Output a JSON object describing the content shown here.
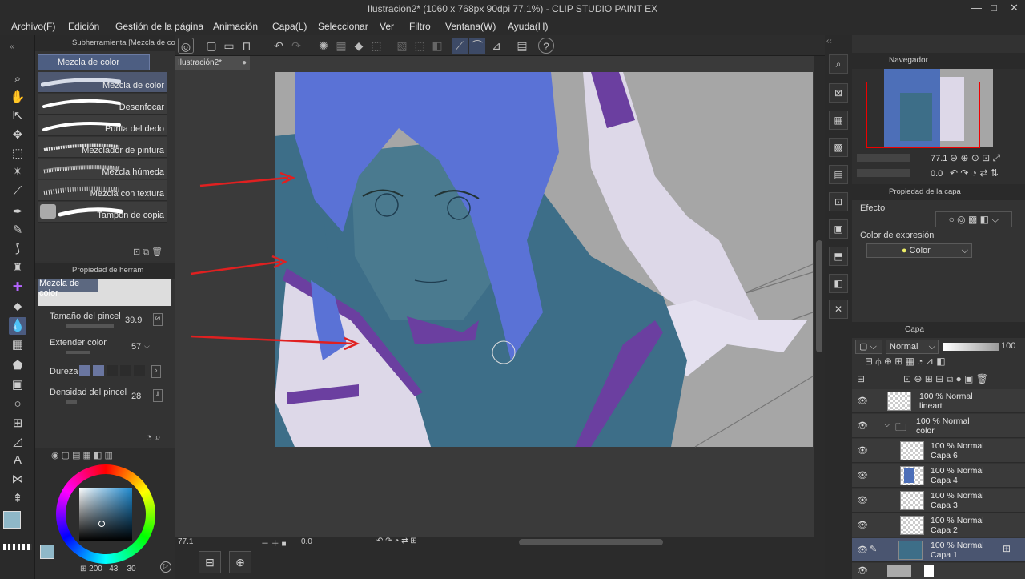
{
  "title": "Ilustración2* (1060 x 768px 90dpi 77.1%)  - CLIP STUDIO PAINT EX",
  "window_controls": {
    "minimize": "—",
    "maximize": "□",
    "close": "✕"
  },
  "menu": [
    "Archivo(F)",
    "Edición",
    "Gestión de la página",
    "Animación",
    "Capa(L)",
    "Seleccionar",
    "Ver",
    "Filtro",
    "Ventana(W)",
    "Ayuda(H)"
  ],
  "subtool_panel": {
    "title": "Subherramienta [Mezcla de co",
    "group": "Mezcla de color",
    "brushes": [
      "Mezcla de color",
      "Desenfocar",
      "Punta del dedo",
      "Mezclador de pintura",
      "Mezcla húmeda",
      "Mezcla con textura",
      "Tampón de copia"
    ]
  },
  "tool_property": {
    "title": "Propiedad de herram",
    "tool_name": "Mezcla de color",
    "brush_size_label": "Tamaño del pincel",
    "brush_size": "39.9",
    "extend_color_label": "Extender color",
    "extend_color": "57",
    "hardness_label": "Dureza",
    "brush_density_label": "Densidad del pincel",
    "brush_density": "28"
  },
  "color_panel": {
    "r": "200",
    "g": "43",
    "b": "30",
    "main_color": "#8fb8c8",
    "sub_color": "#2a3a48"
  },
  "document": {
    "tab_label": "Ilustración2*"
  },
  "status": {
    "zoom": "77.1",
    "rotation": "0.0"
  },
  "navigator": {
    "title": "Navegador",
    "zoom": "77.1",
    "rotation": "0.0"
  },
  "layer_property": {
    "title": "Propiedad de la capa",
    "effect_label": "Efecto",
    "expression_color_label": "Color de expresión",
    "expression_color_value": "Color"
  },
  "layers_panel": {
    "title": "Capa",
    "blend_mode": "Normal",
    "opacity": "100",
    "layers": [
      {
        "line1": "100 % Normal",
        "line2": "lineart"
      },
      {
        "line1": "100 % Normal",
        "line2": "color"
      },
      {
        "line1": "100 % Normal",
        "line2": "Capa 6"
      },
      {
        "line1": "100 % Normal",
        "line2": "Capa 4"
      },
      {
        "line1": "100 % Normal",
        "line2": "Capa 3"
      },
      {
        "line1": "100 % Normal",
        "line2": "Capa 2"
      },
      {
        "line1": "100 % Normal",
        "line2": "Capa 1"
      }
    ]
  },
  "colors": {
    "accent": "#5b6fcf",
    "hair": "#5a72d6",
    "skin": "#3d6e88",
    "cloth_purple": "#6b3fa0",
    "canvas_bg": "#a6a6a6"
  }
}
